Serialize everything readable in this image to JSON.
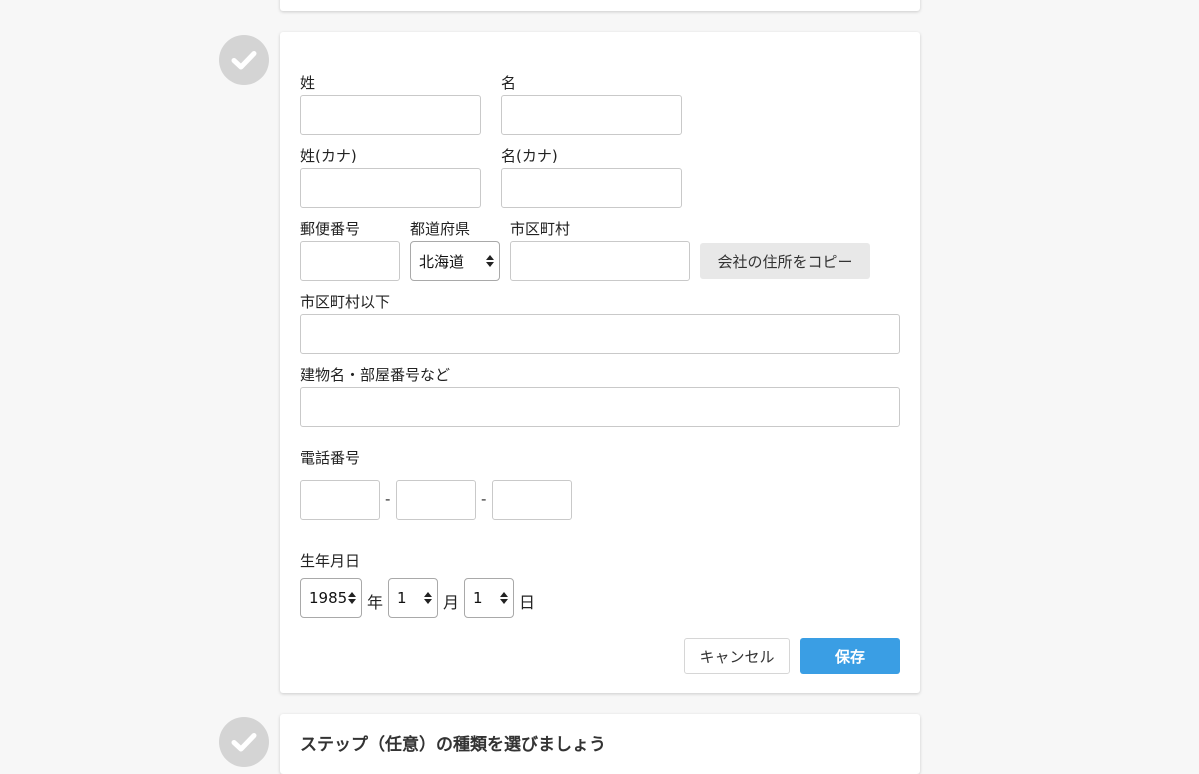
{
  "form": {
    "last_name_label": "姓",
    "first_name_label": "名",
    "last_name_kana_label": "姓(カナ)",
    "first_name_kana_label": "名(カナ)",
    "postal_code_label": "郵便番号",
    "prefecture_label": "都道府県",
    "prefecture_value": "北海道",
    "city_label": "市区町村",
    "copy_address_label": "会社の住所をコピー",
    "address_line_label": "市区町村以下",
    "building_label": "建物名・部屋番号など",
    "phone_label": "電話番号",
    "phone_separator": "-",
    "birthday_label": "生年月日",
    "birth_year_value": "1985",
    "year_unit": "年",
    "birth_month_value": "1",
    "month_unit": "月",
    "birth_day_value": "1",
    "day_unit": "日",
    "cancel_label": "キャンセル",
    "save_label": "保存"
  },
  "next_section": {
    "title_partial": "ステップ（任意）の種類を選びましょう"
  },
  "colors": {
    "primary_button": "#3a9ee4",
    "check_circle": "#d4d4d4"
  },
  "icons": {
    "step_status": "check-circle-icon"
  }
}
